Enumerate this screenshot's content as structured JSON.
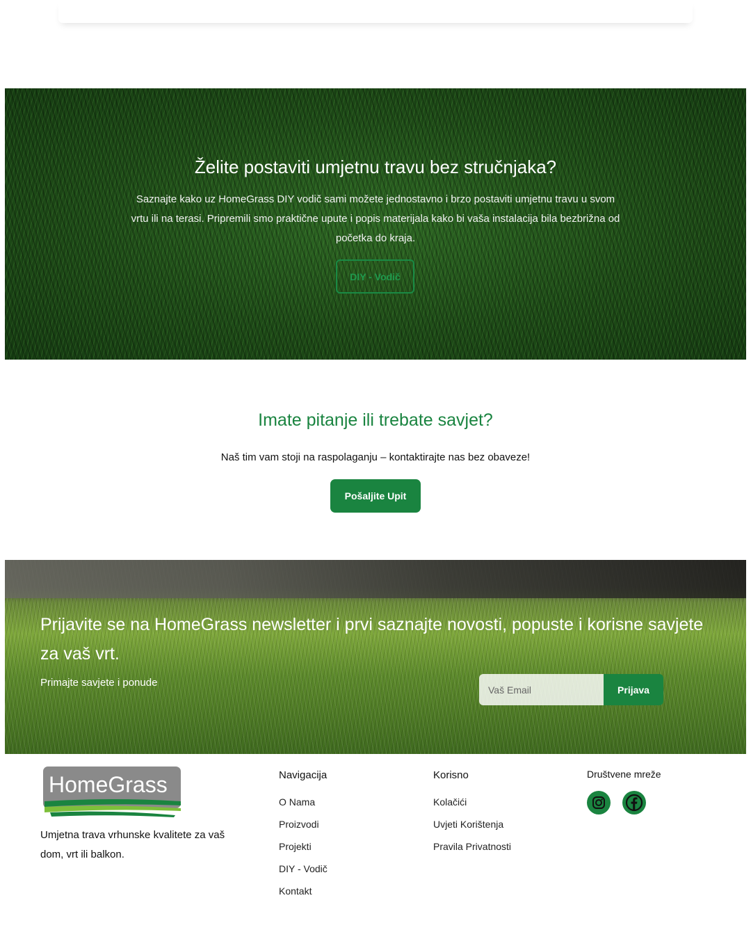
{
  "hero": {
    "title": "Želite postaviti umjetnu travu bez stručnjaka?",
    "text": "Saznajte kako uz HomeGrass DIY vodič sami možete jednostavno i brzo postaviti umjetnu travu u svom vrtu ili na terasi. Pripremili smo praktične upute i popis materijala kako bi vaša instalacija bila bezbrižna od početka do kraja.",
    "button": "DIY - Vodič"
  },
  "contact": {
    "title": "Imate pitanje ili trebate savjet?",
    "text": "Naš tim vam stoji na raspolaganju – kontaktirajte nas bez obaveze!",
    "button": "Pošaljite Upit"
  },
  "newsletter": {
    "title": "Prijavite se na HomeGrass newsletter i prvi saznajte novosti, popuste i korisne savjete za vaš vrt.",
    "subtitle": "Primajte savjete i ponude",
    "email_placeholder": "Vaš Email",
    "button": "Prijava"
  },
  "footer": {
    "logo_text": "HomeGrass",
    "description": "Umjetna trava vrhunske kvalitete za vaš dom, vrt ili balkon.",
    "nav_title": "Navigacija",
    "nav_items": [
      "O Nama",
      "Proizvodi",
      "Projekti",
      "DIY - Vodič",
      "Kontakt"
    ],
    "useful_title": "Korisno",
    "useful_items": [
      "Kolačići",
      "Uvjeti Korištenja",
      "Pravila Privatnosti"
    ],
    "social_title": "Društvene mreže",
    "social_icons": [
      "instagram-icon",
      "facebook-icon"
    ]
  },
  "colors": {
    "brand_green": "#1a8440",
    "logo_gray": "#8a8a8a"
  }
}
